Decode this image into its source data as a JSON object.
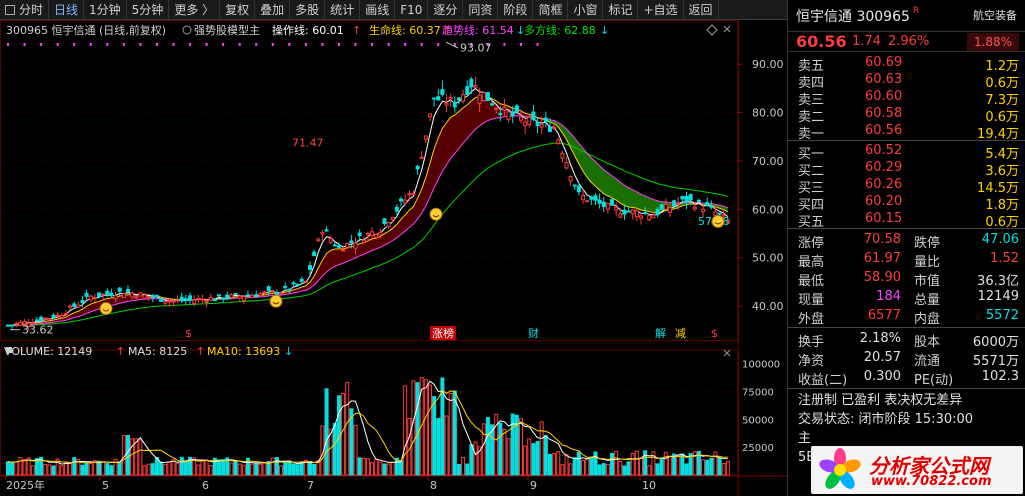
{
  "toolbar": [
    {
      "label": "分时",
      "active": false
    },
    {
      "label": "日线",
      "active": true
    },
    {
      "label": "1分钟",
      "active": false
    },
    {
      "label": "5分钟",
      "active": false
    },
    {
      "label": "更多 〉",
      "active": false
    },
    {
      "label": "复权",
      "active": false
    },
    {
      "label": "叠加",
      "active": false
    },
    {
      "label": "多股",
      "active": false
    },
    {
      "label": "统计",
      "active": false
    },
    {
      "label": "画线",
      "active": false
    },
    {
      "label": "F10",
      "active": false
    },
    {
      "label": "逐分",
      "active": false
    },
    {
      "label": "同资",
      "active": false
    },
    {
      "label": "阶段",
      "active": false
    },
    {
      "label": "简框",
      "active": false
    },
    {
      "label": "小窗",
      "active": false
    },
    {
      "label": "标记",
      "active": false
    },
    {
      "label": "+自选",
      "active": false
    },
    {
      "label": "返回",
      "active": false
    }
  ],
  "chart_header": {
    "code_name": "300965  恒宇信通 (日线,前复权)",
    "indicator": "强势股模型主",
    "lines": [
      {
        "label": "操作线: 60.01",
        "arrow": "↑",
        "color": "#ffffff"
      },
      {
        "label": "生命线: 60.37",
        "arrow": "↑",
        "color": "#ffd200"
      },
      {
        "label": "趋势线: 61.54",
        "arrow": "↓",
        "color": "#ff40ff"
      },
      {
        "label": "多方线: 62.88",
        "arrow": "↓",
        "color": "#00e000"
      }
    ]
  },
  "vol_header": [
    {
      "label": "VOLUME: 12149",
      "arrow": "↑",
      "color": "#e0e0e0"
    },
    {
      "label": "MA5: 8125",
      "arrow": "↑",
      "color": "#e0e0e0"
    },
    {
      "label": "MA10: 13693",
      "arrow": "↓",
      "color": "#ffd200"
    }
  ],
  "chart_data": [
    {
      "type": "candlestick",
      "ylim": [
        33,
        95
      ],
      "yticks": [
        "90.00",
        "80.00",
        "70.00",
        "60.00",
        "50.00",
        "40.00"
      ],
      "xticks": [
        "2025年",
        "5",
        "6",
        "7",
        "8",
        "9",
        "10"
      ],
      "annotations": {
        "high": "93.07",
        "peak2": "71.47",
        "low": "33.62",
        "last": "57.38"
      },
      "events": [
        "$",
        "涨榜",
        "财",
        "解",
        "减",
        "$"
      ],
      "lines": [
        "操作线",
        "生命线",
        "趋势线",
        "多方线"
      ]
    },
    {
      "type": "bar",
      "ylim": [
        0,
        105000
      ],
      "yticks": [
        "100000",
        "75000",
        "50000",
        "25000"
      ],
      "series": [
        {
          "name": "VOLUME"
        },
        {
          "name": "MA5"
        },
        {
          "name": "MA10"
        }
      ]
    }
  ],
  "panel": {
    "name": "恒宇信通",
    "code": "300965",
    "r_flag": "R",
    "industry": "航空装备",
    "price": "60.56",
    "change": "1.74",
    "change_pct": "2.96%",
    "industry_pct": "1.88%",
    "asks": [
      {
        "label": "卖五",
        "yen": "¥",
        "price": "60.69",
        "vol": "1.2万"
      },
      {
        "label": "卖四",
        "yen": "",
        "price": "60.63",
        "vol": "0.6万"
      },
      {
        "label": "卖三",
        "yen": "",
        "price": "60.60",
        "vol": "7.3万"
      },
      {
        "label": "卖二",
        "yen": "",
        "price": "60.58",
        "vol": "0.6万"
      },
      {
        "label": "卖一",
        "yen": "",
        "price": "60.56",
        "vol": "19.4万"
      }
    ],
    "bids": [
      {
        "label": "买一",
        "price": "60.52",
        "vol": "5.4万"
      },
      {
        "label": "买二",
        "price": "60.29",
        "vol": "3.6万"
      },
      {
        "label": "买三",
        "price": "60.26",
        "vol": "14.5万"
      },
      {
        "label": "买四",
        "price": "60.20",
        "vol": "1.8万"
      },
      {
        "label": "买五",
        "price": "60.15",
        "vol": "0.6万"
      }
    ],
    "stats1": [
      [
        "涨停",
        "70.58",
        "red",
        "跌停",
        "47.06",
        "grn"
      ],
      [
        "最高",
        "61.97",
        "red",
        "量比",
        "1.52",
        "red"
      ],
      [
        "最低",
        "58.90",
        "red",
        "市值",
        "36.3亿",
        "wht"
      ],
      [
        "现量",
        "184",
        "mag",
        "总量",
        "12149",
        "wht"
      ],
      [
        "外盘",
        "6577",
        "red",
        "内盘",
        "5572",
        "grn"
      ]
    ],
    "stats2": [
      [
        "换手",
        "2.18%",
        "wht",
        "股本",
        "6000万",
        "wht"
      ],
      [
        "净资",
        "20.57",
        "wht",
        "流通",
        "5571万",
        "wht"
      ],
      [
        "收益(二)",
        "0.300",
        "wht",
        "PE(动)",
        "102.3",
        "wht"
      ]
    ],
    "reg": "注册制  已盈利  表决权无差异",
    "trade": "交易状态: 闭市阶段 15:30:00",
    "zhu": "主",
    "fiveE": "5E",
    "logo1": "分析家公式网",
    "logo2": "www.70822.com"
  }
}
